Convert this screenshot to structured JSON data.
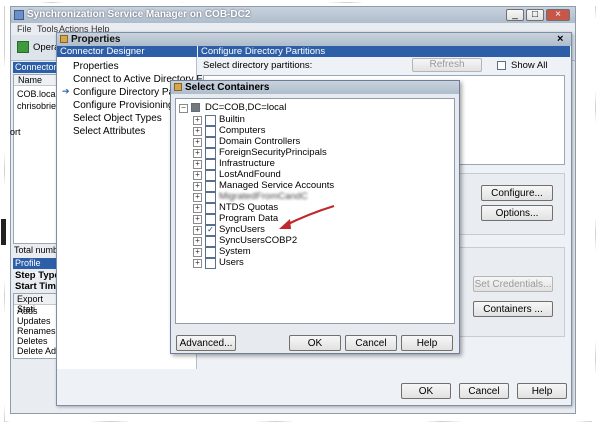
{
  "main_window": {
    "title": "Synchronization Service Manager on COB-DC2",
    "menu": [
      "File",
      "Tools",
      "Actions",
      "Help"
    ],
    "toolbar_label": "Operati",
    "connectors_tab": "Connectors",
    "grid_header": "Name",
    "rows": [
      "COB.local",
      "chrisobrien.c"
    ],
    "side_fragment": "ort",
    "total_label": "Total number",
    "profile_name_label": "Profile Name:",
    "step_type_label": "Step Type:",
    "start_time_label": "Start Time:",
    "export_header": "Export Stati",
    "export_rows": [
      "Adds",
      "Updates",
      "Renames",
      "Deletes",
      "Delete Adds"
    ]
  },
  "properties": {
    "title": "Properties",
    "nav_header": "Connector Designer",
    "nav_items": [
      "Properties",
      "Connect to Active Directory F",
      "Configure Directory Partitions",
      "Configure Provisioning Hierarc",
      "Select Object Types",
      "Select Attributes"
    ],
    "panel_header": "Configure Directory Partitions",
    "select_label": "Select directory partitions:",
    "refresh_label": "Refresh",
    "show_all_label": "Show All",
    "configure_label": "Configure...",
    "options_label": "Options...",
    "set_credentials_label": "Set Credentials...",
    "containers_label": "Containers ...",
    "ok_label": "OK",
    "cancel_label": "Cancel",
    "help_label": "Help"
  },
  "select_containers": {
    "title": "Select Containers",
    "root": "DC=COB,DC=local",
    "items": [
      {
        "label": "Builtin",
        "checked": false
      },
      {
        "label": "Computers",
        "checked": false
      },
      {
        "label": "Domain Controllers",
        "checked": false
      },
      {
        "label": "ForeignSecurityPrincipals",
        "checked": false
      },
      {
        "label": "Infrastructure",
        "checked": false
      },
      {
        "label": "LostAndFound",
        "checked": false
      },
      {
        "label": "Managed Service Accounts",
        "checked": false
      },
      {
        "label": "MigratedFromCandC",
        "checked": false,
        "blurred": true
      },
      {
        "label": "NTDS Quotas",
        "checked": false
      },
      {
        "label": "Program Data",
        "checked": false
      },
      {
        "label": "SyncUsers",
        "checked": true
      },
      {
        "label": "SyncUsersCOBP2",
        "checked": false
      },
      {
        "label": "System",
        "checked": false
      },
      {
        "label": "Users",
        "checked": false
      }
    ],
    "advanced_label": "Advanced...",
    "ok_label": "OK",
    "cancel_label": "Cancel",
    "help_label": "Help"
  },
  "colors": {
    "arrow": "#c0282d",
    "title_bar": "#b7c5d5",
    "checkbox_border": "#5a6f8a"
  }
}
